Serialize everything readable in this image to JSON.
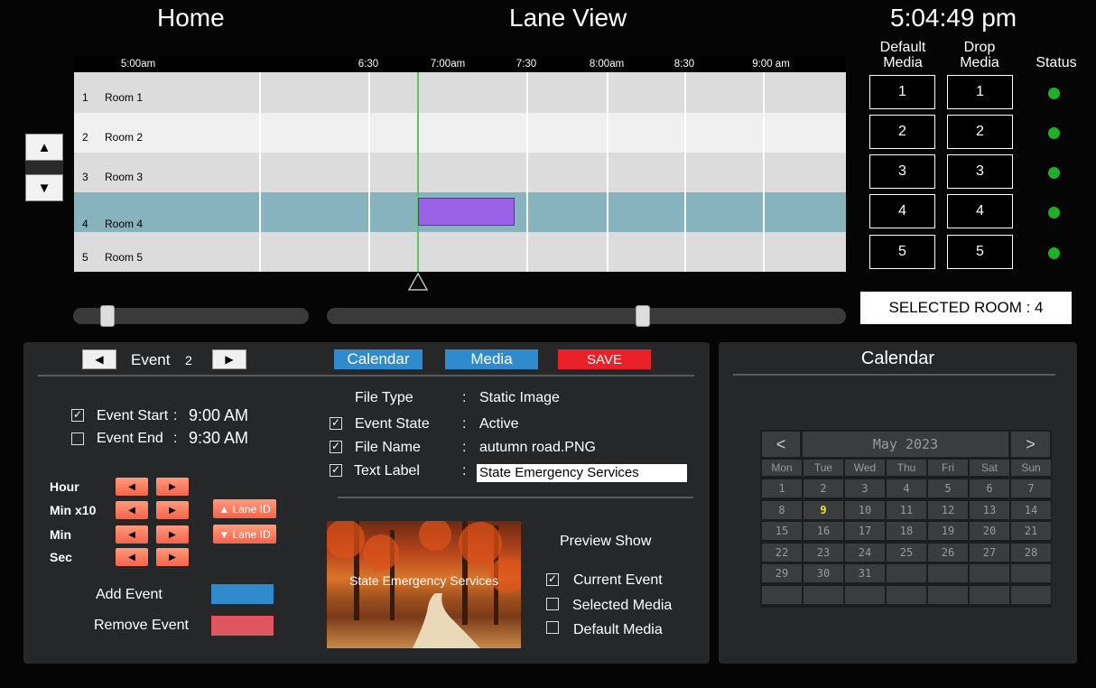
{
  "header": {
    "home": "Home",
    "title": "Lane View",
    "clock": "5:04:49 pm"
  },
  "timeline": {
    "ticks": [
      "5:00am",
      "6:30",
      "7:00am",
      "7:30",
      "8:00am",
      "8:30",
      "9:00 am"
    ],
    "lanes": [
      {
        "num": "1",
        "name": "Room 1"
      },
      {
        "num": "2",
        "name": "Room 2"
      },
      {
        "num": "3",
        "name": "Room 3"
      },
      {
        "num": "4",
        "name": "Room 4"
      },
      {
        "num": "5",
        "name": "Room 5"
      }
    ],
    "up_label": "▲",
    "down_label": "▼"
  },
  "media_grid": {
    "default_header": "Default\nMedia",
    "drop_header": "Drop\nMedia",
    "status_header": "Status",
    "rows": [
      "1",
      "2",
      "3",
      "4",
      "5"
    ],
    "status_color": "#1fb02a"
  },
  "selected_room": "SELECTED ROOM : 4",
  "event_panel": {
    "prev": "◀",
    "next": "▶",
    "label": "Event",
    "number": "2",
    "calendar_btn": "Calendar",
    "media_btn": "Media",
    "save_btn": "SAVE",
    "event_start_label": "Event Start",
    "event_start_value": "9:00 AM",
    "event_end_label": "Event End",
    "event_end_value": "9:30 AM",
    "colon": ":",
    "controls": [
      "Hour",
      "Min  x10",
      "Min",
      "Sec"
    ],
    "lane_up": "▲ Lane ID",
    "lane_down": "▼ Lane ID",
    "add_event": "Add Event",
    "remove_event": "Remove Event",
    "file_type_label": "File Type",
    "file_type_value": "Static Image",
    "event_state_label": "Event  State",
    "event_state_value": "Active",
    "file_name_label": "File Name",
    "file_name_value": "autumn road.PNG",
    "text_label_label": "Text Label",
    "text_label_value": "State Emergency Services",
    "preview_caption": "State Emergency Services",
    "preview_show": "Preview Show",
    "current_event": "Current Event",
    "selected_media": "Selected Media",
    "default_media": "Default Media",
    "check": "✓"
  },
  "calendar": {
    "title": "Calendar",
    "prev": "<",
    "next": ">",
    "month": "May 2023",
    "weekdays": [
      "Mon",
      "Tue",
      "Wed",
      "Thu",
      "Fri",
      "Sat",
      "Sun"
    ],
    "days": [
      "1",
      "2",
      "3",
      "4",
      "5",
      "6",
      "7",
      "8",
      "9",
      "10",
      "11",
      "12",
      "13",
      "14",
      "15",
      "16",
      "17",
      "18",
      "19",
      "20",
      "21",
      "22",
      "23",
      "24",
      "25",
      "26",
      "27",
      "28",
      "29",
      "30",
      "31",
      "",
      "",
      "",
      "",
      "",
      "",
      "",
      "",
      "",
      "",
      ""
    ],
    "today": "9",
    "today_color": "#f1e227"
  }
}
